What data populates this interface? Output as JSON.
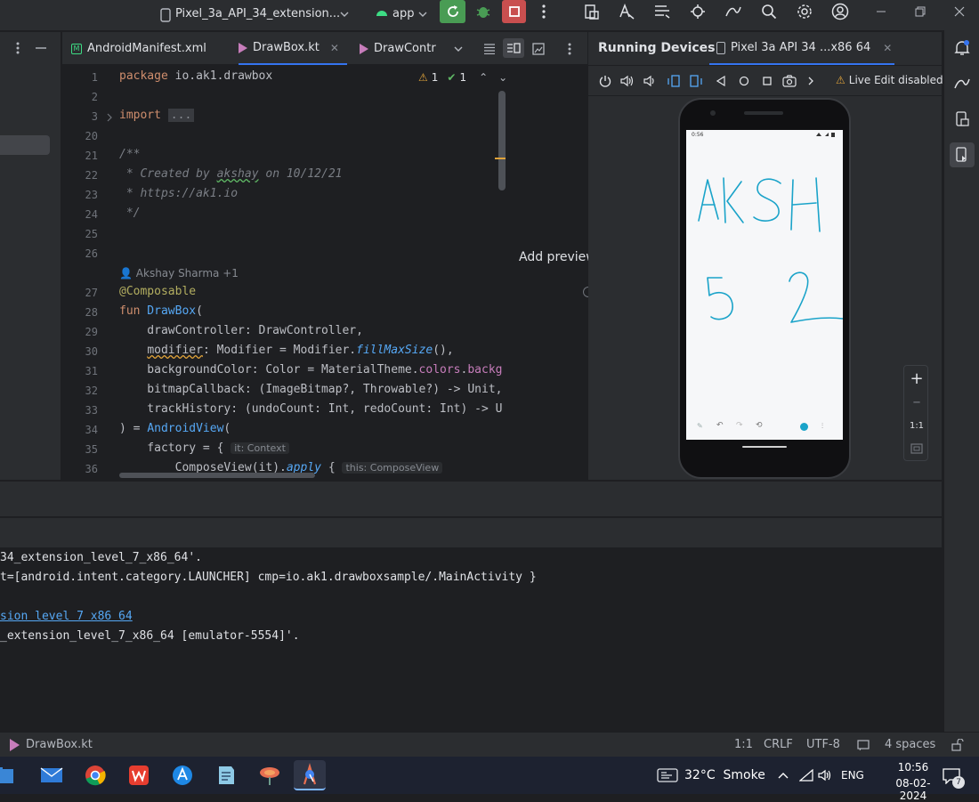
{
  "titlebar": {
    "device_selector": "Pixel_3a_API_34_extension...",
    "run_config": "app"
  },
  "editor": {
    "tabs": [
      {
        "label": "AndroidManifest.xml"
      },
      {
        "label": "DrawBox.kt"
      },
      {
        "label": "DrawContr"
      }
    ],
    "inspection": {
      "warnings": "1",
      "ok": "1"
    },
    "code_lines": [
      {
        "num": "1"
      },
      {
        "num": "2"
      },
      {
        "num": "3"
      },
      {
        "num": "20"
      },
      {
        "num": "21"
      },
      {
        "num": "22"
      },
      {
        "num": "23"
      },
      {
        "num": "24"
      },
      {
        "num": "25"
      },
      {
        "num": "26"
      },
      {
        "num": "27"
      },
      {
        "num": "28"
      },
      {
        "num": "29"
      },
      {
        "num": "30"
      },
      {
        "num": "31"
      },
      {
        "num": "32"
      },
      {
        "num": "33"
      },
      {
        "num": "34"
      },
      {
        "num": "35"
      },
      {
        "num": "36"
      }
    ],
    "code": {
      "l1_kw": "package",
      "l1_rest": " io.ak1.drawbox",
      "l3_kw": "import",
      "l3_fold": "...",
      "l21": "/**",
      "l22a": " * Created by ",
      "l22b": "akshay",
      "l22c": " on 10/12/21",
      "l23": " * https://ak1.io",
      "l24": " */",
      "author": "Akshay Sharma +1",
      "l27": "@Composable",
      "l28_kw": "fun",
      "l28_fn": " DrawBox",
      "l28_rest": "(",
      "l29": "    drawController: DrawController,",
      "l30a": "    ",
      "l30b": "modifier",
      "l30c": ": Modifier = Modifier.",
      "l30d": "fillMaxSize",
      "l30e": "(),",
      "l31a": "    backgroundColor: Color = MaterialTheme.",
      "l31b": "colors",
      "l31c": ".",
      "l31d": "backg",
      "l32": "    bitmapCallback: (ImageBitmap?, Throwable?) -> Unit,",
      "l33": "    trackHistory: (undoCount: Int, redoCount: Int) -> U",
      "l34a": ") = ",
      "l34b": "AndroidView",
      "l34c": "(",
      "l35a": "    factory = {",
      "l35_hint": "it: Context",
      "l36a": "        ComposeView(",
      "l36b": "it",
      "l36c": ").",
      "l36d": "apply",
      "l36e": " {",
      "l36_hint": "this: ComposeView"
    },
    "preview_label": "Add preview"
  },
  "running_devices": {
    "title": "Running Devices",
    "device_tab": "Pixel 3a API 34 ...x86 64",
    "live_edit": "Live Edit disabled",
    "zoom_label": "1:1",
    "phone": {
      "status_time": "0:56",
      "drawing_text": "AKSH 52"
    }
  },
  "console": {
    "lines": [
      "34_extension_level_7_x86_64'.",
      "t=[android.intent.category.LAUNCHER] cmp=io.ak1.drawboxsample/.MainActivity }",
      "",
      "sion level 7 x86 64",
      "_extension_level_7_x86_64 [emulator-5554]'."
    ]
  },
  "statusbar": {
    "file": "DrawBox.kt",
    "position": "1:1",
    "line_sep": "CRLF",
    "encoding": "UTF-8",
    "indent": "4 spaces"
  },
  "taskbar": {
    "weather": "32°C  Smoke",
    "lang": "ENG",
    "time": "10:56",
    "date": "08-02-2024",
    "notif_count": "7"
  },
  "colors": {
    "accent": "#3574f0",
    "run_green": "#499c54",
    "stop_red": "#c94f4f",
    "ink_cyan": "#1aa3c9"
  }
}
